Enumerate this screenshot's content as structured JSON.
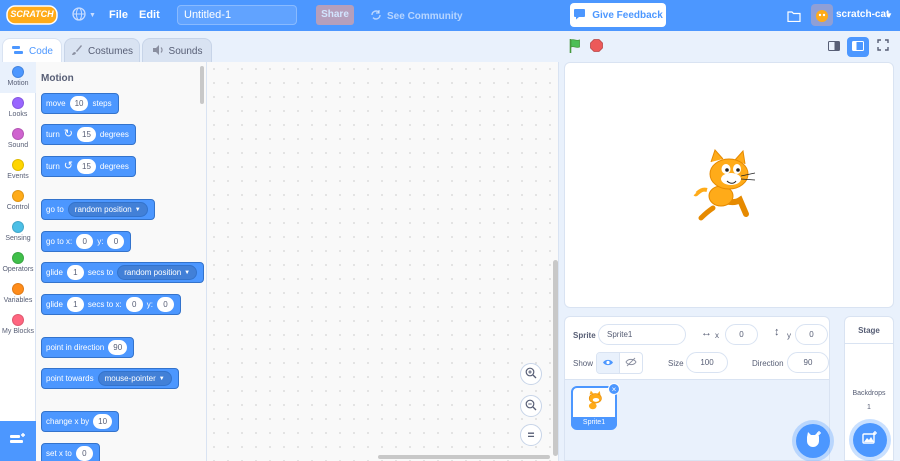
{
  "menubar": {
    "logo_text": "SCRATCH",
    "file": "File",
    "edit": "Edit",
    "project_title": "Untitled-1",
    "share": "Share",
    "see_community": "See Community",
    "give_feedback": "Give Feedback",
    "username": "scratch-cat"
  },
  "tabs": {
    "code": "Code",
    "costumes": "Costumes",
    "sounds": "Sounds"
  },
  "categories": [
    {
      "label": "Motion",
      "color": "#4c97ff"
    },
    {
      "label": "Looks",
      "color": "#9966ff"
    },
    {
      "label": "Sound",
      "color": "#cf63cf"
    },
    {
      "label": "Events",
      "color": "#ffd500"
    },
    {
      "label": "Control",
      "color": "#ffab19"
    },
    {
      "label": "Sensing",
      "color": "#4cbfe6"
    },
    {
      "label": "Operators",
      "color": "#40bf4a"
    },
    {
      "label": "Variables",
      "color": "#ff8c1a"
    },
    {
      "label": "My Blocks",
      "color": "#ff6680"
    }
  ],
  "palette": {
    "heading": "Motion",
    "blocks": {
      "move": {
        "a": "move",
        "v": "10",
        "b": "steps"
      },
      "turn_right": {
        "a": "turn",
        "v": "15",
        "b": "degrees"
      },
      "turn_left": {
        "a": "turn",
        "v": "15",
        "b": "degrees"
      },
      "goto": {
        "a": "go to",
        "dd": "random position"
      },
      "goto_xy": {
        "a": "go to x:",
        "x": "0",
        "b": "y:",
        "y": "0"
      },
      "glide_to": {
        "a": "glide",
        "v": "1",
        "b": "secs to",
        "dd": "random position"
      },
      "glide_xy": {
        "a": "glide",
        "v": "1",
        "b": "secs to x:",
        "x": "0",
        "c": "y:",
        "y": "0"
      },
      "point_dir": {
        "a": "point in direction",
        "v": "90"
      },
      "point_towards": {
        "a": "point towards",
        "dd": "mouse-pointer"
      },
      "change_x": {
        "a": "change x by",
        "v": "10"
      },
      "set_x": {
        "a": "set x to",
        "v": "0"
      }
    }
  },
  "sprite_info": {
    "sprite_label": "Sprite",
    "sprite_name": "Sprite1",
    "x_label": "x",
    "x": "0",
    "y_label": "y",
    "y": "0",
    "show_label": "Show",
    "size_label": "Size",
    "size": "100",
    "direction_label": "Direction",
    "direction": "90"
  },
  "sprite_list": [
    {
      "name": "Sprite1"
    }
  ],
  "stage_selector": {
    "title": "Stage",
    "backdrops_label": "Backdrops",
    "backdrops_count": "1"
  },
  "colors": {
    "motion": "#4c97ff",
    "menubar": "#4c97ff",
    "accent": "#4c97ff"
  }
}
